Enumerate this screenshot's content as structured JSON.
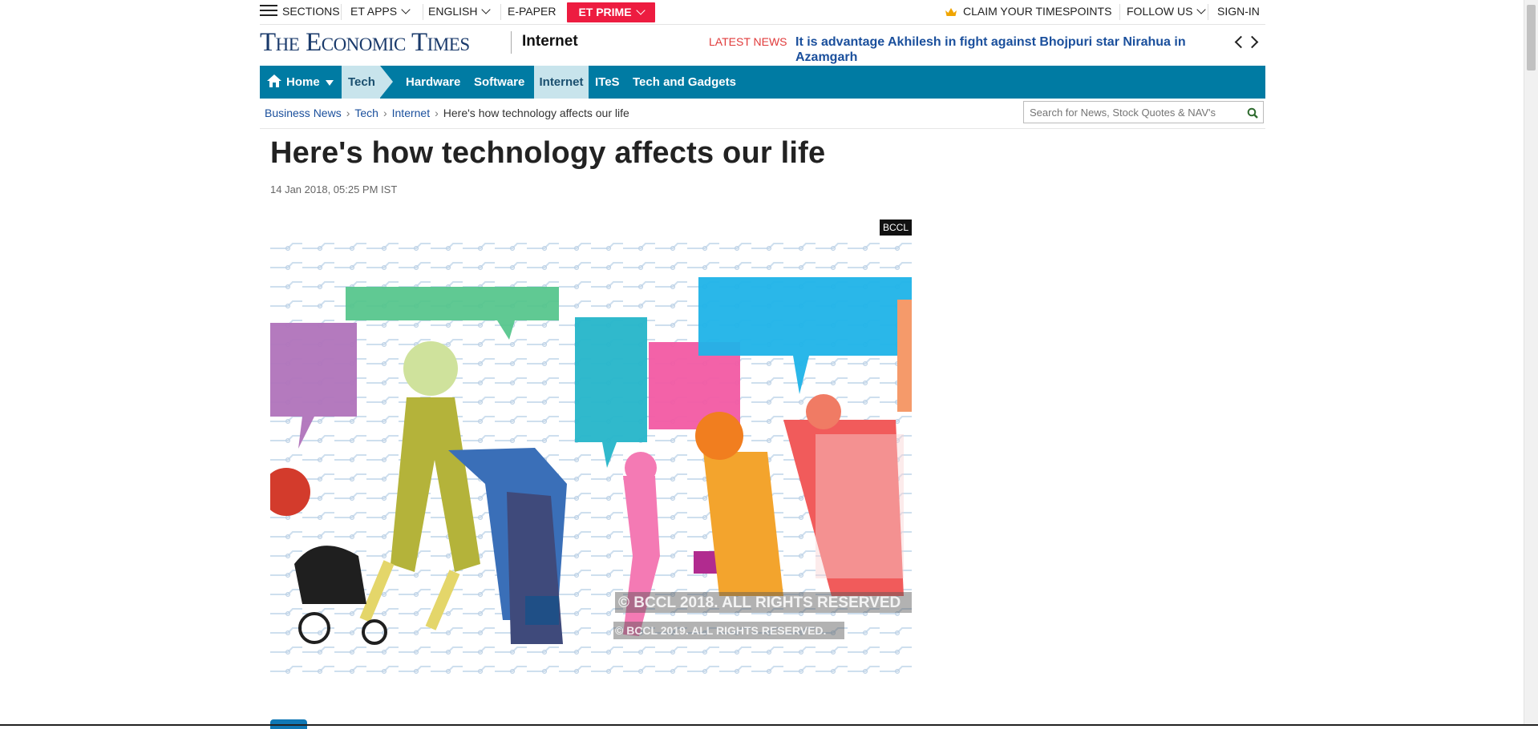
{
  "topbar": {
    "sections": "SECTIONS",
    "et_apps": "ET APPS",
    "language": "ENGLISH",
    "epaper": "E-PAPER",
    "prime": "ET PRIME",
    "timespoints": "CLAIM YOUR TIMESPOINTS",
    "follow": "FOLLOW US",
    "signin": "SIGN-IN"
  },
  "header": {
    "logo": "The Economic Times",
    "section": "Internet",
    "latest_label": "LATEST NEWS",
    "latest_headline": "It is advantage Akhilesh in fight against Bhojpuri star Nirahua in Azamgarh"
  },
  "nav": {
    "items": [
      "Home",
      "Tech",
      "Hardware",
      "Software",
      "Internet",
      "ITeS",
      "Tech and Gadgets"
    ]
  },
  "breadcrumb": {
    "items": [
      "Business News",
      "Tech",
      "Internet"
    ],
    "current": "Here's how technology affects our life"
  },
  "search": {
    "placeholder": "Search for News, Stock Quotes & NAV's"
  },
  "article": {
    "headline": "Here's how technology affects our life",
    "date": "14 Jan 2018, 05:25 PM IST",
    "image_tag": "BCCL",
    "watermark1": "© BCCL 2018. ALL RIGHTS RESERVED",
    "watermark2": "© BCCL 2019. ALL RIGHTS RESERVED."
  },
  "colors": {
    "nav_bg": "#007ba3",
    "nav_active": "#c8e4ec",
    "prime": "#ed1c40",
    "link": "#1a4f9c",
    "latest": "#e03a3a"
  }
}
